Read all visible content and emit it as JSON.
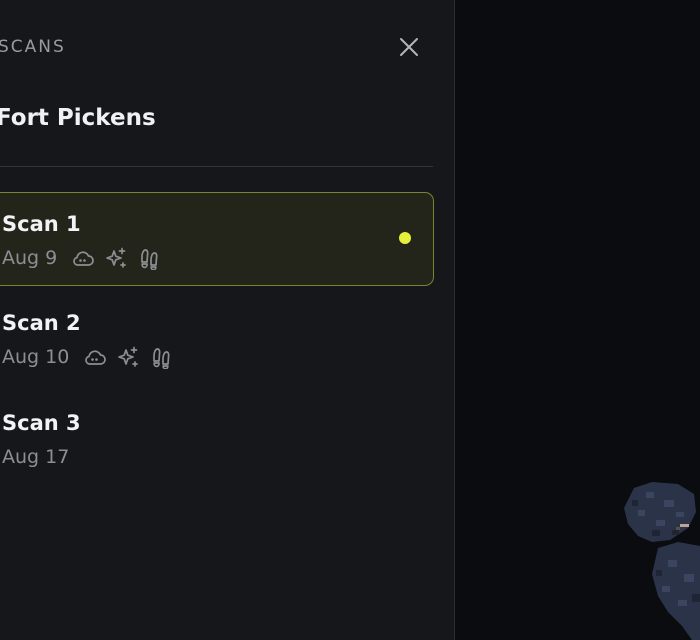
{
  "panel": {
    "label": "SCANS",
    "project_title": "Fort Pickens",
    "close_label": "close"
  },
  "scans": [
    {
      "name": "Scan 1",
      "date": "Aug 9",
      "selected": true,
      "features": [
        "cloud-icon",
        "sparkles-icon",
        "footprints-icon"
      ]
    },
    {
      "name": "Scan 2",
      "date": "Aug 10",
      "selected": false,
      "features": [
        "cloud-icon",
        "sparkles-icon",
        "footprints-icon"
      ]
    },
    {
      "name": "Scan 3",
      "date": "Aug 17",
      "selected": false,
      "features": []
    }
  ],
  "colors": {
    "accent": "#e5f03a",
    "selected_border": "#7b8430",
    "panel_bg": "#16171b",
    "viewport_bg": "#0b0c0f"
  }
}
